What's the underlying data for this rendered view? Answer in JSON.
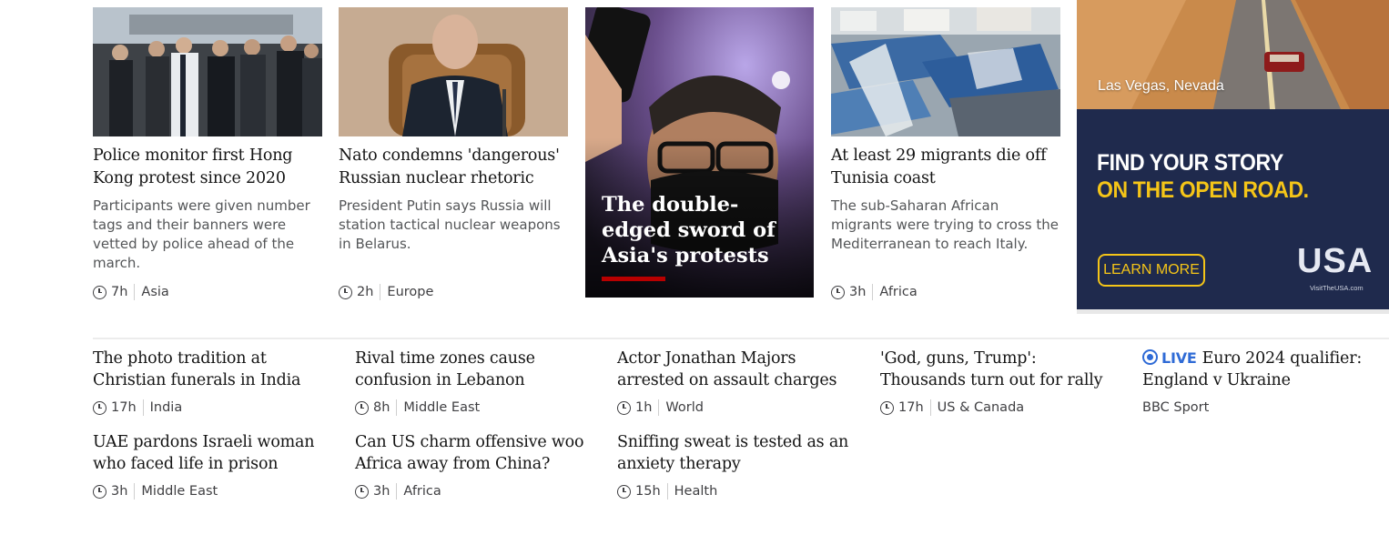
{
  "top_stories": [
    {
      "headline": "Police monitor first Hong Kong protest since 2020",
      "summary": "Participants were given number tags and their banners were vetted by police ahead of the march.",
      "time": "7h",
      "section": "Asia"
    },
    {
      "headline": "Nato condemns 'dangerous' Russian nuclear rhetoric",
      "summary": "President Putin says Russia will station tactical nuclear weapons in Belarus.",
      "time": "2h",
      "section": "Europe"
    },
    {
      "headline": "At least 29 migrants die off Tunisia coast",
      "summary": "The sub-Saharan African migrants were trying to cross the Mediterranean to reach Italy.",
      "time": "3h",
      "section": "Africa"
    }
  ],
  "feature": {
    "headline": "The double-edged sword of Asia's protests"
  },
  "ad": {
    "location": "Las Vegas, Nevada",
    "line1": "FIND YOUR STORY",
    "line2": "ON THE OPEN ROAD.",
    "cta": "LEARN MORE",
    "logo": "USA",
    "url": "VisitTheUSA.com"
  },
  "more_stories": [
    {
      "headline": "The photo tradition at Christian funerals in India",
      "time": "17h",
      "section": "India"
    },
    {
      "headline": "Rival time zones cause confusion in Lebanon",
      "time": "8h",
      "section": "Middle East"
    },
    {
      "headline": "Actor Jonathan Majors arrested on assault charges",
      "time": "1h",
      "section": "World"
    },
    {
      "headline": "'God, guns, Trump': Thousands turn out for rally",
      "time": "17h",
      "section": "US & Canada"
    },
    {
      "live_label": "LIVE",
      "headline": "Euro 2024 qualifier: England v Ukraine",
      "source": "BBC Sport"
    },
    {
      "headline": "UAE pardons Israeli woman who faced life in prison",
      "time": "3h",
      "section": "Middle East"
    },
    {
      "headline": "Can US charm offensive woo Africa away from China?",
      "time": "3h",
      "section": "Africa"
    },
    {
      "headline": "Sniffing sweat is tested as an anxiety therapy",
      "time": "15h",
      "section": "Health"
    }
  ],
  "colors": {
    "live": "#2f6bd6",
    "accent": "#b80000",
    "ad_navy": "#1f2a4d",
    "ad_yellow": "#f5c518"
  }
}
